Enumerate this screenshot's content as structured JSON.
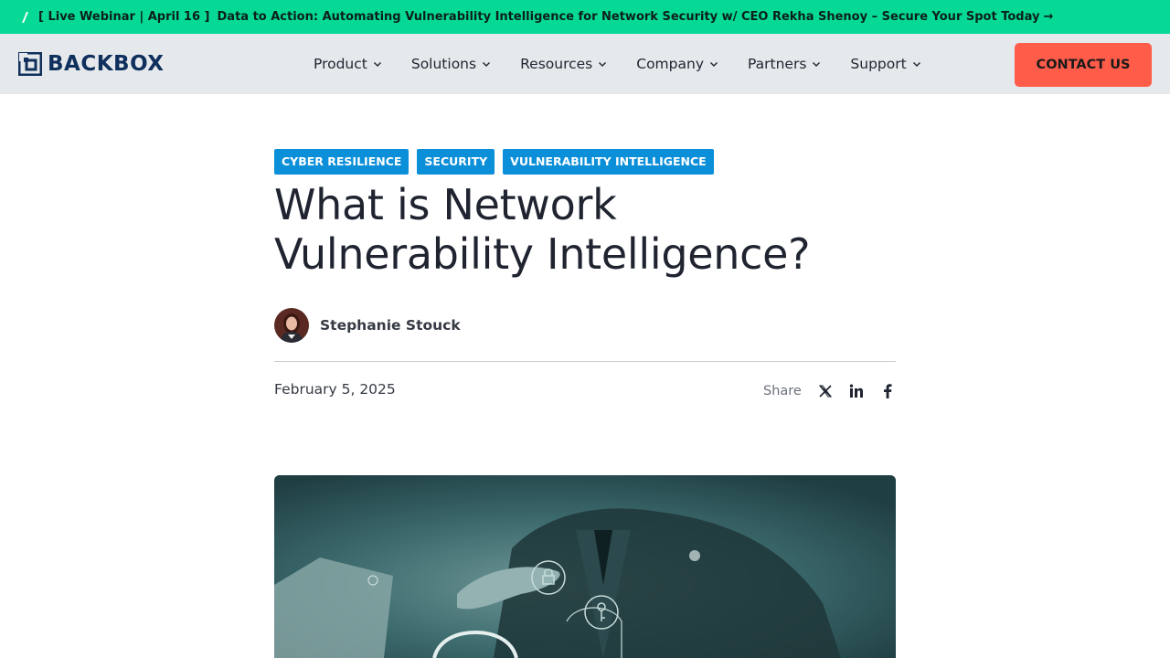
{
  "announcement": {
    "bracket_text": "[ Live Webinar | April 16 ]",
    "message": "Data to Action: Automating Vulnerability Intelligence for Network Security w/ CEO Rekha Shenoy – Secure Your Spot Today",
    "arrow": "→"
  },
  "header": {
    "logo_text": "BACKBOX",
    "nav": [
      {
        "label": "Product"
      },
      {
        "label": "Solutions"
      },
      {
        "label": "Resources"
      },
      {
        "label": "Company"
      },
      {
        "label": "Partners"
      },
      {
        "label": "Support"
      }
    ],
    "contact_label": "CONTACT US"
  },
  "article": {
    "tags": [
      "CYBER RESILIENCE",
      "SECURITY",
      "VULNERABILITY INTELLIGENCE"
    ],
    "title_line1": "What is Network",
    "title_line2": "Vulnerability Intelligence?",
    "author": "Stephanie Stouck",
    "date": "February 5, 2025",
    "share_label": "Share",
    "share_icons": [
      "x-icon",
      "linkedin-icon",
      "facebook-icon"
    ]
  },
  "colors": {
    "announcement_bg": "#06d995",
    "header_bg": "#e5e9ec",
    "contact_bg": "#ff5c4a",
    "tag_bg": "#0b8fd9",
    "logo": "#0f2f5c"
  }
}
